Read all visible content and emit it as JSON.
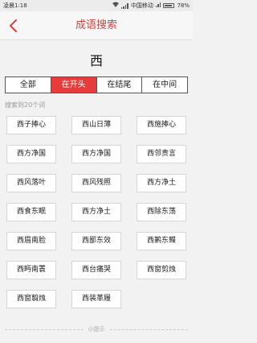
{
  "status_bar": {
    "left_text": "凌晨1:18",
    "carrier": "中国移动",
    "battery": "78%"
  },
  "header": {
    "title": "成语搜索",
    "back_icon": "chevron-left-icon",
    "accent_color": "#d94040"
  },
  "query": {
    "char": "西"
  },
  "tabs": [
    {
      "label": "全部",
      "active": false
    },
    {
      "label": "在开头",
      "active": true
    },
    {
      "label": "在结尾",
      "active": false
    },
    {
      "label": "在中间",
      "active": false
    }
  ],
  "result_count_text": "搜索到20个词",
  "results": [
    "西子捧心",
    "西山日薄",
    "西施捧心",
    "西方净国",
    "西方净国",
    "西邻责言",
    "西风落叶",
    "西风残照",
    "西方净土",
    "西食东眠",
    "西方净土",
    "西除东荡",
    "西眉南脸",
    "西鄙东效",
    "西鹣东鲽",
    "西眄南瞏",
    "西台痛哭",
    "西窗剪烛",
    "西窗翦烛",
    "西装革履"
  ],
  "footer_tip": "小提示"
}
